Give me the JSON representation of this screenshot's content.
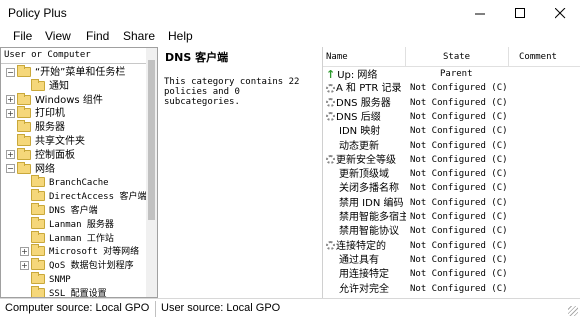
{
  "window": {
    "title": "Policy Plus"
  },
  "menu": [
    "File",
    "View",
    "Find",
    "Share",
    "Help"
  ],
  "tree": {
    "header": "User or Computer",
    "items": [
      {
        "label": "“开始”菜单和任务栏",
        "indent": 0,
        "exp": "−",
        "mono": false
      },
      {
        "label": "通知",
        "indent": 1,
        "exp": "",
        "mono": false
      },
      {
        "label": "Windows 组件",
        "indent": 0,
        "exp": "+",
        "mono": false
      },
      {
        "label": "打印机",
        "indent": 0,
        "exp": "+",
        "mono": false
      },
      {
        "label": "服务器",
        "indent": 0,
        "exp": "",
        "mono": false
      },
      {
        "label": "共享文件夹",
        "indent": 0,
        "exp": "",
        "mono": false
      },
      {
        "label": "控制面板",
        "indent": 0,
        "exp": "+",
        "mono": false
      },
      {
        "label": "网络",
        "indent": 0,
        "exp": "−",
        "mono": false
      },
      {
        "label": "BranchCache",
        "indent": 1,
        "exp": "",
        "mono": true
      },
      {
        "label": "DirectAccess 客户端",
        "indent": 1,
        "exp": "",
        "mono": true
      },
      {
        "label": "DNS 客户端",
        "indent": 1,
        "exp": "",
        "mono": true,
        "selected": true
      },
      {
        "label": "Lanman 服务器",
        "indent": 1,
        "exp": "",
        "mono": true
      },
      {
        "label": "Lanman 工作站",
        "indent": 1,
        "exp": "",
        "mono": true
      },
      {
        "label": "Microsoft 对等网络",
        "indent": 1,
        "exp": "+",
        "mono": true
      },
      {
        "label": "QoS 数据包计划程序",
        "indent": 1,
        "exp": "+",
        "mono": true
      },
      {
        "label": "SNMP",
        "indent": 1,
        "exp": "",
        "mono": true
      },
      {
        "label": "SSL 配置设置",
        "indent": 1,
        "exp": "",
        "mono": true
      }
    ]
  },
  "middle": {
    "title": "DNS 客户端",
    "description": "This category contains 22 policies and 0 subcategories."
  },
  "list": {
    "columns": [
      "Name",
      "State",
      "Comment"
    ],
    "rows": [
      {
        "name": "Up: 网络",
        "state": "Parent",
        "icon": "up"
      },
      {
        "name": "A 和 PTR 记录",
        "state": "Not Configured (C)",
        "icon": "gear"
      },
      {
        "name": "DNS 服务器",
        "state": "Not Configured (C)",
        "icon": "gear"
      },
      {
        "name": "DNS 后缀",
        "state": "Not Configured (C)",
        "icon": "gear"
      },
      {
        "name": "IDN 映射",
        "state": "Not Configured (C)",
        "icon": "none"
      },
      {
        "name": "动态更新",
        "state": "Not Configured (C)",
        "icon": "none"
      },
      {
        "name": "更新安全等级",
        "state": "Not Configured (C)",
        "icon": "gear"
      },
      {
        "name": "更新顶级域",
        "state": "Not Configured (C)",
        "icon": "none"
      },
      {
        "name": "关闭多播名称",
        "state": "Not Configured (C)",
        "icon": "none"
      },
      {
        "name": "禁用 IDN 编码",
        "state": "Not Configured (C)",
        "icon": "none"
      },
      {
        "name": "禁用智能多宿主",
        "state": "Not Configured (C)",
        "icon": "none"
      },
      {
        "name": "禁用智能协议",
        "state": "Not Configured (C)",
        "icon": "none"
      },
      {
        "name": "连接特定的",
        "state": "Not Configured (C)",
        "icon": "gear"
      },
      {
        "name": "通过具有",
        "state": "Not Configured (C)",
        "icon": "none"
      },
      {
        "name": "用连接特定",
        "state": "Not Configured (C)",
        "icon": "none"
      },
      {
        "name": "允许对完全",
        "state": "Not Configured (C)",
        "icon": "none"
      }
    ]
  },
  "status": {
    "computer": "Computer source:  Local GPO",
    "user": "User source:  Local GPO"
  }
}
